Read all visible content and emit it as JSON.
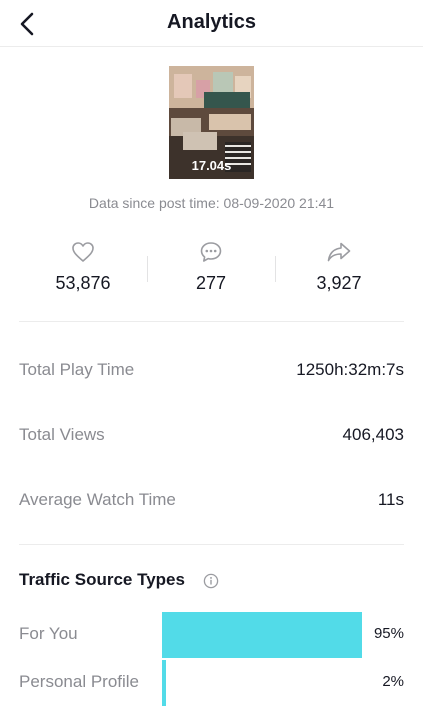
{
  "header": {
    "title": "Analytics",
    "back_icon": "chevron-left-icon"
  },
  "video": {
    "duration": "17.04s"
  },
  "data_since": "Data since post time: 08-09-2020 21:41",
  "engagement": {
    "likes": {
      "icon": "heart-icon",
      "value": "53,876"
    },
    "comments": {
      "icon": "comment-icon",
      "value": "277"
    },
    "shares": {
      "icon": "share-icon",
      "value": "3,927"
    }
  },
  "metrics": [
    {
      "label": "Total Play Time",
      "value": "1250h:32m:7s"
    },
    {
      "label": "Total Views",
      "value": "406,403"
    },
    {
      "label": "Average Watch Time",
      "value": "11s"
    }
  ],
  "traffic": {
    "title": "Traffic Source Types",
    "info_icon": "info-icon",
    "accent_color": "#52dbe8",
    "sources": [
      {
        "label": "For You",
        "value": "95%",
        "fraction": 0.95
      },
      {
        "label": "Personal Profile",
        "value": "2%",
        "fraction": 0.02
      }
    ]
  }
}
